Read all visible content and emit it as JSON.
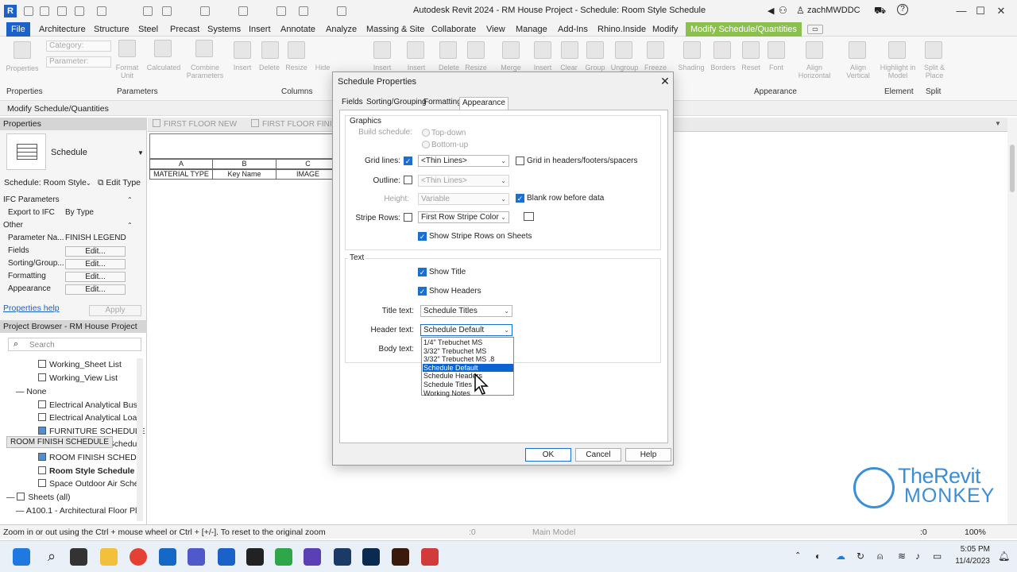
{
  "titlebar": {
    "logo": "R",
    "title": "Autodesk Revit 2024 - RM House Project - Schedule: Room Style Schedule",
    "user": "zachMWDDC",
    "help": "?"
  },
  "ribbon_tabs": [
    "File",
    "Architecture",
    "Structure",
    "Steel",
    "Precast",
    "Systems",
    "Insert",
    "Annotate",
    "Analyze",
    "Massing & Site",
    "Collaborate",
    "View",
    "Manage",
    "Add-Ins",
    "Rhino.Inside",
    "Modify",
    "Modify Schedule/Quantities"
  ],
  "ribbon": {
    "category_placeholder": "Category:",
    "parameter_placeholder": "Parameter:",
    "buttons": [
      "Properties",
      "Format Unit",
      "Calculated",
      "Combine Parameters",
      "Insert",
      "Delete",
      "Resize",
      "Hide",
      "Unhide",
      "Insert",
      "Insert",
      "Delete",
      "Resize",
      "Merge",
      "Insert",
      "Clear",
      "Group",
      "Ungroup",
      "Freeze",
      "Shading",
      "Borders",
      "Reset",
      "Font",
      "Align Horizontal",
      "Align Vertical",
      "Highlight in Model",
      "Split & Place"
    ],
    "panels": [
      "Properties",
      "Parameters",
      "Columns",
      "Appearance",
      "Element",
      "Split"
    ],
    "context_label": "Modify Schedule/Quantities"
  },
  "properties": {
    "header": "Properties",
    "type_name": "Schedule",
    "selector": "Schedule: Room Style",
    "edit_type": "Edit Type",
    "sections": [
      {
        "title": "IFC Parameters",
        "rows": [
          {
            "name": "Export to IFC",
            "value": "By Type"
          }
        ]
      },
      {
        "title": "Other",
        "rows": [
          {
            "name": "Parameter Na...",
            "value": "FINISH LEGEND"
          },
          {
            "name": "Fields",
            "value": "Edit..."
          },
          {
            "name": "Sorting/Group...",
            "value": "Edit..."
          },
          {
            "name": "Formatting",
            "value": "Edit..."
          },
          {
            "name": "Appearance",
            "value": "Edit..."
          }
        ]
      }
    ],
    "help_link": "Properties help",
    "apply": "Apply"
  },
  "browser": {
    "header": "Project Browser - RM House Project",
    "search_placeholder": "Search",
    "items": [
      "Working_Sheet List",
      "Working_View List",
      "None",
      "Electrical Analytical Bus",
      "Electrical Analytical Load",
      "FURNITURE SCHEDULE",
      "e Schedu",
      "ROOM FINISH SCHEDU",
      "Room Style Schedule",
      "Space Outdoor Air Sche",
      "Sheets (all)",
      "A100.1 - Architectural Floor Pla"
    ],
    "tooltip": "ROOM FINISH SCHEDULE"
  },
  "view_tabs": [
    "FIRST FLOOR NEW",
    "FIRST FLOOR FINIS"
  ],
  "schedule": {
    "letters": [
      "A",
      "B",
      "C"
    ],
    "headers": [
      "MATERIAL TYPE",
      "Key Name",
      "IMAGE"
    ]
  },
  "dialog": {
    "title": "Schedule Properties",
    "tabs": [
      "Fields",
      "Sorting/Grouping",
      "Formatting",
      "Appearance"
    ],
    "active_tab": "Appearance",
    "graphics": {
      "group_label": "Graphics",
      "build_schedule_label": "Build schedule:",
      "top_down": "Top-down",
      "bottom_up": "Bottom-up",
      "grid_lines_label": "Grid lines:",
      "grid_lines_value": "<Thin Lines>",
      "grid_in_headers": "Grid in headers/footers/spacers",
      "outline_label": "Outline:",
      "outline_value": "<Thin Lines>",
      "height_label": "Height:",
      "height_value": "Variable",
      "blank_row": "Blank row before data",
      "stripe_rows_label": "Stripe Rows:",
      "stripe_rows_value": "First Row Stripe Color",
      "show_stripe_rows": "Show Stripe Rows on Sheets"
    },
    "text": {
      "group_label": "Text",
      "show_title": "Show Title",
      "show_headers": "Show Headers",
      "title_text_label": "Title text:",
      "title_text_value": "Schedule Titles",
      "header_text_label": "Header text:",
      "header_text_value": "Schedule Default",
      "body_text_label": "Body text:",
      "dropdown_options": [
        "1/4\" Trebuchet MS",
        "3/32\" Trebuchet MS",
        "3/32\" Trebuchet MS .8",
        "Schedule Default",
        "Schedule Headers",
        "Schedule Titles",
        "Working Notes"
      ],
      "selected_option": "Schedule Default"
    },
    "buttons": {
      "ok": "OK",
      "cancel": "Cancel",
      "help": "Help"
    }
  },
  "status": {
    "hint": "Zoom in or out using the Ctrl + mouse wheel or Ctrl + [+/-]. To reset to the original zoom",
    "workset_count": ":0",
    "model": "Main Model",
    "filter_count": ":0",
    "zoom": "100%"
  },
  "taskbar": {
    "time": "5:05 PM",
    "date": "11/4/2023"
  },
  "watermark": {
    "line1": "TheRevit",
    "line2": "MONKEY"
  },
  "colors": {
    "accent": "#1a62c9",
    "context_tab": "#8bc04c",
    "selection": "#0a64d2",
    "watermark": "#3a8fd8"
  }
}
